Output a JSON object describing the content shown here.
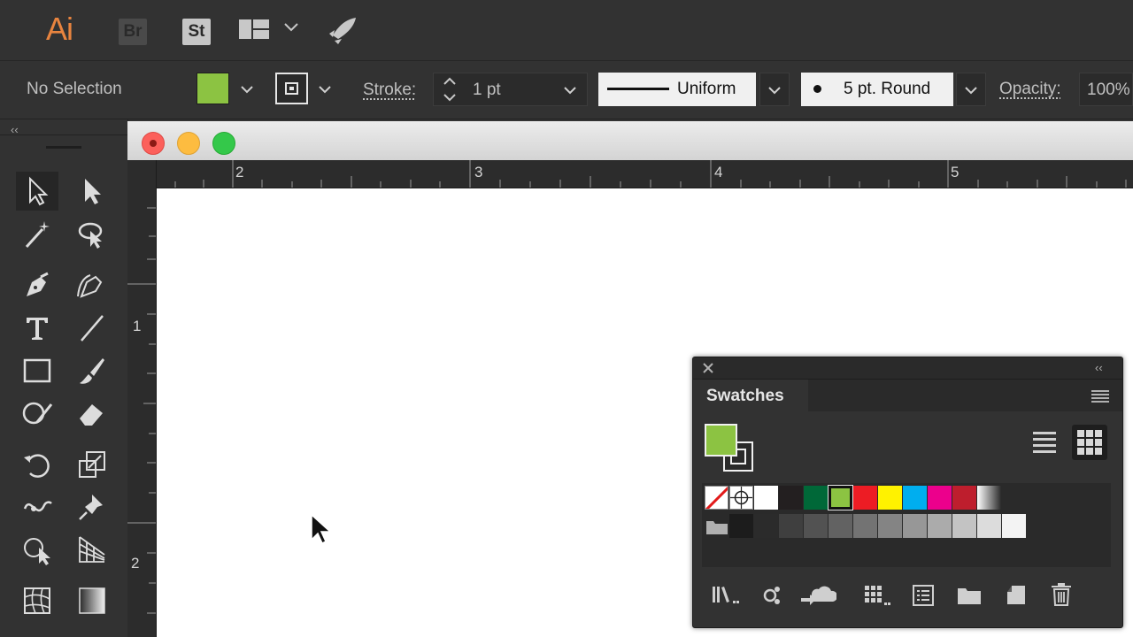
{
  "app": {
    "logo": "Ai",
    "bridge": "Br",
    "stock": "St"
  },
  "control_bar": {
    "selection_label": "No Selection",
    "fill_color": "#8cc342",
    "stroke_label": "Stroke:",
    "stroke_weight": "1 pt",
    "variable_width_label": "Uniform",
    "brush_label": "5 pt. Round",
    "opacity_label": "Opacity:",
    "opacity_value": "100%"
  },
  "rulers": {
    "horizontal": [
      "2",
      "3",
      "4",
      "5"
    ],
    "vertical": [
      "1",
      "2"
    ]
  },
  "swatches_panel": {
    "title": "Swatches",
    "fill_color": "#8cc342",
    "row1": [
      "none",
      "registration",
      "#ffffff",
      "#231f20",
      "#006838",
      "#8cc342",
      "#ed1c24",
      "#fff200",
      "#00aeef",
      "#ec008c",
      "#be1e2d",
      "gradient"
    ],
    "row2": [
      "folder",
      "#1c1c1c",
      "#2b2b2b",
      "#3f3f3f",
      "#525252",
      "#626262",
      "#737373",
      "#848484",
      "#979797",
      "#ababab",
      "#c3c3c3",
      "#dcdcdc",
      "#f3f3f3"
    ]
  }
}
